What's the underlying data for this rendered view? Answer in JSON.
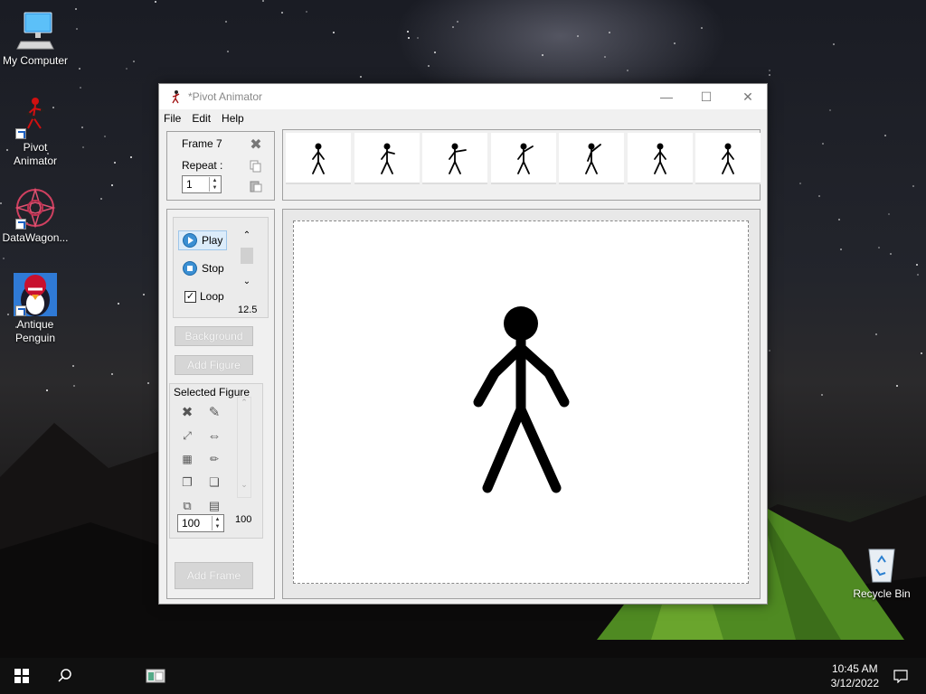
{
  "desktop": {
    "icons": [
      {
        "label": "My Computer",
        "icon": "computer-icon"
      },
      {
        "label": "Pivot Animator",
        "icon": "pivot-stickman-icon"
      },
      {
        "label": "DataWagon...",
        "icon": "datawagon-icon"
      },
      {
        "label": "Antique Penguin",
        "icon": "penguin-icon"
      },
      {
        "label": "Recycle Bin",
        "icon": "recycle-bin-icon"
      }
    ]
  },
  "window": {
    "title": "*Pivot Animator",
    "menu": [
      "File",
      "Edit",
      "Help"
    ],
    "frame_info": {
      "frame_label": "Frame 7",
      "repeat_label": "Repeat :",
      "repeat_value": "1"
    },
    "frames_count": 7,
    "playback": {
      "play_label": "Play",
      "stop_label": "Stop",
      "loop_label": "Loop",
      "loop_checked": true,
      "speed_value": "12.5"
    },
    "buttons": {
      "background": "Background",
      "add_figure": "Add Figure",
      "add_frame": "Add Frame"
    },
    "selected_figure": {
      "label": "Selected Figure",
      "size_value": "100",
      "alpha_value": "100"
    }
  },
  "taskbar": {
    "time": "10:45 AM",
    "date": "3/12/2022"
  },
  "colors": {
    "accent": "#3b8fd3",
    "taskbar": "#101010",
    "window_bg": "#f0f0f0"
  }
}
